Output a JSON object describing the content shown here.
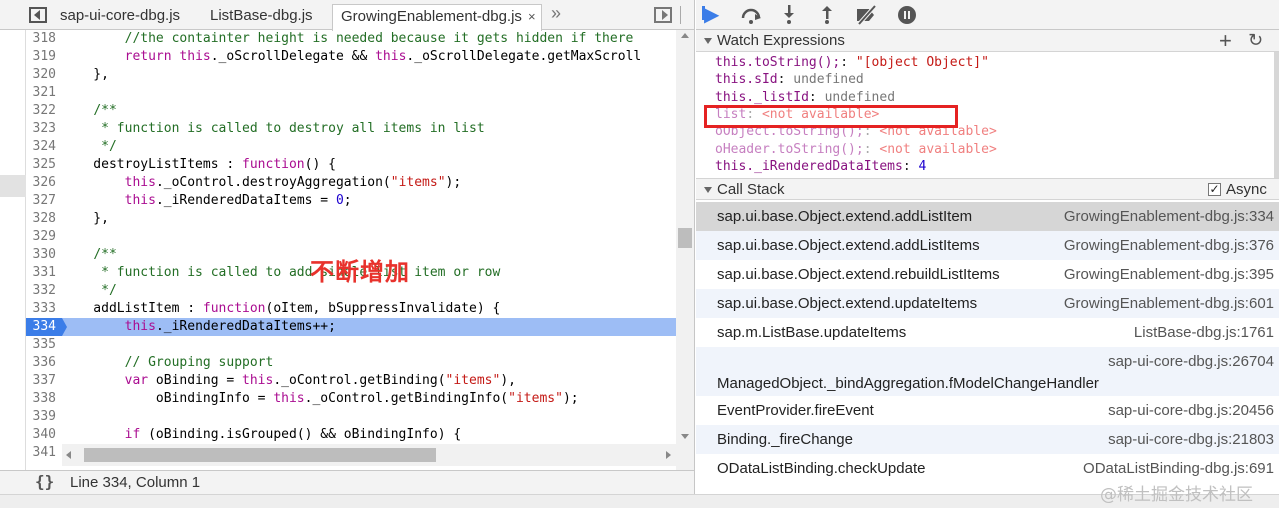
{
  "tabs": [
    {
      "label": "sap-ui-core-dbg.js",
      "active": false
    },
    {
      "label": "ListBase-dbg.js",
      "active": false
    },
    {
      "label": "GrowingEnablement-dbg.js",
      "active": true
    }
  ],
  "tab_close_glyph": "×",
  "overflow_glyph": "»",
  "code": [
    {
      "n": "318",
      "tokens": [
        [
          "tx",
          "        "
        ],
        [
          "cm",
          "//the containter height is needed because it gets hidden if there"
        ]
      ]
    },
    {
      "n": "319",
      "tokens": [
        [
          "tx",
          "        "
        ],
        [
          "kw",
          "return"
        ],
        [
          "tx",
          " "
        ],
        [
          "kw",
          "this"
        ],
        [
          "tx",
          "._oScrollDelegate && "
        ],
        [
          "kw",
          "this"
        ],
        [
          "tx",
          "._oScrollDelegate.getMaxScroll"
        ]
      ]
    },
    {
      "n": "320",
      "tokens": [
        [
          "tx",
          "    },"
        ]
      ]
    },
    {
      "n": "321",
      "tokens": []
    },
    {
      "n": "322",
      "tokens": [
        [
          "tx",
          "    "
        ],
        [
          "cm",
          "/**"
        ]
      ]
    },
    {
      "n": "323",
      "tokens": [
        [
          "tx",
          "     "
        ],
        [
          "cm",
          "* function is called to destroy all items in list"
        ]
      ]
    },
    {
      "n": "324",
      "tokens": [
        [
          "tx",
          "     "
        ],
        [
          "cm",
          "*/"
        ]
      ]
    },
    {
      "n": "325",
      "tokens": [
        [
          "tx",
          "    destroyListItems : "
        ],
        [
          "kw",
          "function"
        ],
        [
          "tx",
          "() {"
        ]
      ]
    },
    {
      "n": "326",
      "tokens": [
        [
          "tx",
          "        "
        ],
        [
          "kw",
          "this"
        ],
        [
          "tx",
          "._oControl.destroyAggregation("
        ],
        [
          "str",
          "\"items\""
        ],
        [
          "tx",
          ");"
        ]
      ]
    },
    {
      "n": "327",
      "tokens": [
        [
          "tx",
          "        "
        ],
        [
          "kw",
          "this"
        ],
        [
          "tx",
          "._iRenderedDataItems = "
        ],
        [
          "num",
          "0"
        ],
        [
          "tx",
          ";"
        ]
      ]
    },
    {
      "n": "328",
      "tokens": [
        [
          "tx",
          "    },"
        ]
      ]
    },
    {
      "n": "329",
      "tokens": []
    },
    {
      "n": "330",
      "tokens": [
        [
          "tx",
          "    "
        ],
        [
          "cm",
          "/**"
        ]
      ]
    },
    {
      "n": "331",
      "tokens": [
        [
          "tx",
          "     "
        ],
        [
          "cm",
          "* function is called to add single list item or row"
        ]
      ]
    },
    {
      "n": "332",
      "tokens": [
        [
          "tx",
          "     "
        ],
        [
          "cm",
          "*/"
        ]
      ]
    },
    {
      "n": "333",
      "tokens": [
        [
          "tx",
          "    addListItem : "
        ],
        [
          "kw",
          "function"
        ],
        [
          "tx",
          "(oItem, bSuppressInvalidate) {"
        ]
      ]
    },
    {
      "n": "334",
      "exec": true,
      "tokens": [
        [
          "tx",
          "        "
        ],
        [
          "kw",
          "this"
        ],
        [
          "tx",
          "._iRenderedDataItems++;"
        ]
      ]
    },
    {
      "n": "335",
      "tokens": []
    },
    {
      "n": "336",
      "tokens": [
        [
          "tx",
          "        "
        ],
        [
          "cm",
          "// Grouping support"
        ]
      ]
    },
    {
      "n": "337",
      "tokens": [
        [
          "tx",
          "        "
        ],
        [
          "kw",
          "var"
        ],
        [
          "tx",
          " oBinding = "
        ],
        [
          "kw",
          "this"
        ],
        [
          "tx",
          "._oControl.getBinding("
        ],
        [
          "str",
          "\"items\""
        ],
        [
          "tx",
          "),"
        ]
      ]
    },
    {
      "n": "338",
      "tokens": [
        [
          "tx",
          "            oBindingInfo = "
        ],
        [
          "kw",
          "this"
        ],
        [
          "tx",
          "._oControl.getBindingInfo("
        ],
        [
          "str",
          "\"items\""
        ],
        [
          "tx",
          ");"
        ]
      ]
    },
    {
      "n": "339",
      "tokens": []
    },
    {
      "n": "340",
      "tokens": [
        [
          "tx",
          "        "
        ],
        [
          "kw",
          "if"
        ],
        [
          "tx",
          " (oBinding.isGrouped() && oBindingInfo) {"
        ]
      ]
    },
    {
      "n": "341",
      "tokens": []
    }
  ],
  "annotation": "不断增加",
  "status": {
    "pretty_print_glyph": "{}",
    "cursor": "Line 334, Column 1"
  },
  "watch": {
    "title": "Watch Expressions",
    "add_glyph": "+",
    "refresh_glyph": "↻",
    "items": [
      {
        "name": "this.toString();",
        "sep": ": ",
        "value": "\"[object Object]\"",
        "kind": "str"
      },
      {
        "name": "this.sId",
        "sep": ": ",
        "value": "undefined",
        "kind": "undef"
      },
      {
        "name": "this._listId",
        "sep": ": ",
        "value": "undefined",
        "kind": "undef"
      },
      {
        "name": "list",
        "sep": ": ",
        "value": "<not available>",
        "kind": "na"
      },
      {
        "name": "oObject.toString();",
        "sep": ": ",
        "value": "<not available>",
        "kind": "na"
      },
      {
        "name": "oHeader.toString();",
        "sep": ": ",
        "value": "<not available>",
        "kind": "na"
      },
      {
        "name": "this._iRenderedDataItems",
        "sep": ": ",
        "value": "4",
        "kind": "num"
      }
    ]
  },
  "callstack": {
    "title": "Call Stack",
    "async_label": "Async",
    "async_checked": "✓",
    "frames": [
      {
        "fn": "sap.ui.base.Object.extend.addListItem",
        "loc": "GrowingEnablement-dbg.js:334"
      },
      {
        "fn": "sap.ui.base.Object.extend.addListItems",
        "loc": "GrowingEnablement-dbg.js:376"
      },
      {
        "fn": "sap.ui.base.Object.extend.rebuildListItems",
        "loc": "GrowingEnablement-dbg.js:395"
      },
      {
        "fn": "sap.ui.base.Object.extend.updateItems",
        "loc": "GrowingEnablement-dbg.js:601"
      },
      {
        "fn": "sap.m.ListBase.updateItems",
        "loc": "ListBase-dbg.js:1761"
      },
      {
        "fn": "ManagedObject._bindAggregation.fModelChangeHandler",
        "loc": "sap-ui-core-dbg.js:26704"
      },
      {
        "fn": "EventProvider.fireEvent",
        "loc": "sap-ui-core-dbg.js:20456"
      },
      {
        "fn": "Binding._fireChange",
        "loc": "sap-ui-core-dbg.js:21803"
      },
      {
        "fn": "ODataListBinding.checkUpdate",
        "loc": "ODataListBinding-dbg.js:691"
      }
    ]
  },
  "watermark": "@稀土掘金技术社区"
}
